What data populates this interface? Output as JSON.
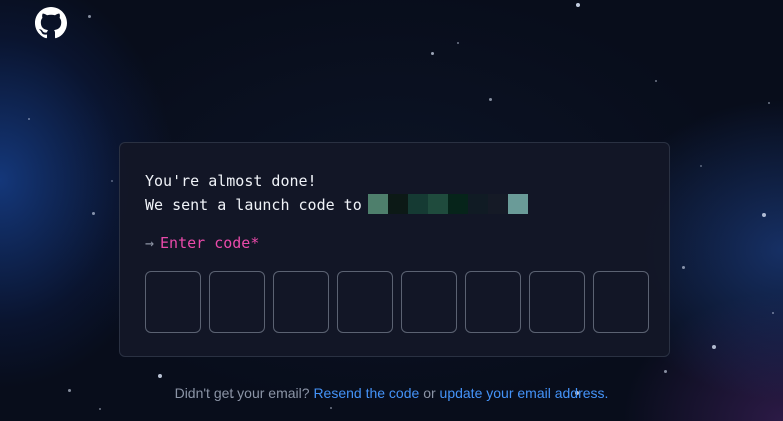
{
  "header": {
    "logo_icon": "github-octocat-icon"
  },
  "card": {
    "title_line1": "You're almost done!",
    "title_line2": "We sent a launch code to",
    "masked_email_colors": [
      "#4e7f6c",
      "#0c1916",
      "#153a33",
      "#1f4b3d",
      "#06241a",
      "#101b24",
      "#151a26",
      "#6a9b98"
    ],
    "prompt_arrow": "→",
    "prompt_label": "Enter code*",
    "code_digits": [
      "",
      "",
      "",
      "",
      "",
      "",
      "",
      ""
    ]
  },
  "footer": {
    "text_before": "Didn't get your email?",
    "resend_link": "Resend the code",
    "text_or": "or",
    "update_link": "update your email address.",
    "link_color": "#4493f8"
  },
  "theme": {
    "accent_pink": "#ea4aaa",
    "background": "#080d1b"
  }
}
